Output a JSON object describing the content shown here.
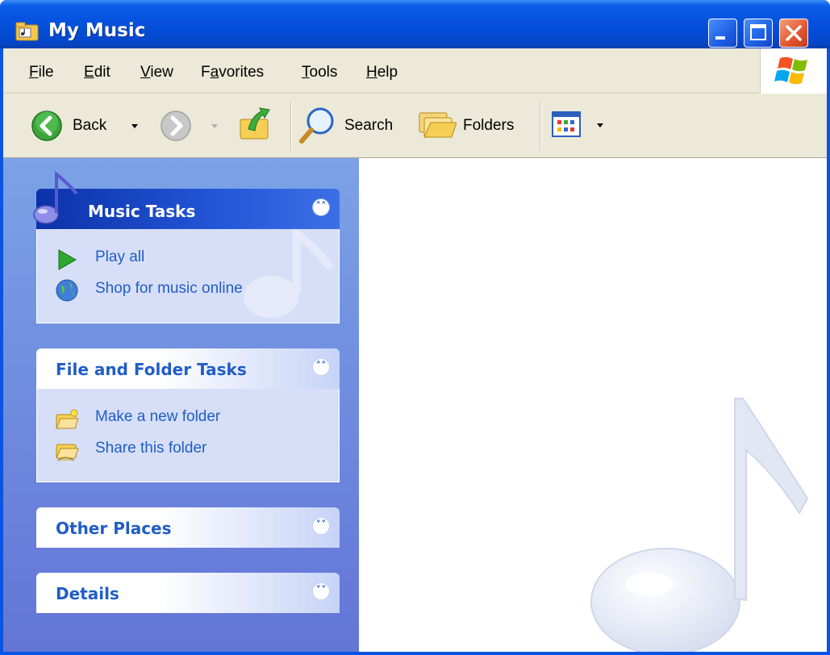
{
  "window": {
    "title": "My Music"
  },
  "menu": [
    "File",
    "Edit",
    "View",
    "Favorites",
    "Tools",
    "Help"
  ],
  "menu_underline": [
    "F",
    "E",
    "V",
    "a",
    "T",
    "H"
  ],
  "toolbar": {
    "back_label": "Back",
    "search_label": "Search",
    "folders_label": "Folders"
  },
  "panels": {
    "music_tasks": {
      "title": "Music Tasks",
      "items": [
        "Play all",
        "Shop for music online"
      ]
    },
    "file_folder_tasks": {
      "title": "File and Folder Tasks",
      "items": [
        "Make a new folder",
        "Share this folder"
      ]
    },
    "other_places": {
      "title": "Other Places"
    },
    "details": {
      "title": "Details"
    }
  },
  "colors": {
    "titlebar": "#0a54e3",
    "task_link": "#215dc6",
    "pane_top": "#7ba2e7",
    "pane_bottom": "#6375d6",
    "chrome": "#ece9d8"
  },
  "icons": [
    "folder-music-icon",
    "back-arrow-icon",
    "forward-arrow-icon",
    "up-folder-icon",
    "search-icon",
    "folders-icon",
    "views-icon",
    "windows-logo-icon",
    "music-note-icon",
    "play-icon",
    "globe-icon",
    "new-folder-icon",
    "share-folder-icon",
    "collapse-icon",
    "expand-icon"
  ]
}
